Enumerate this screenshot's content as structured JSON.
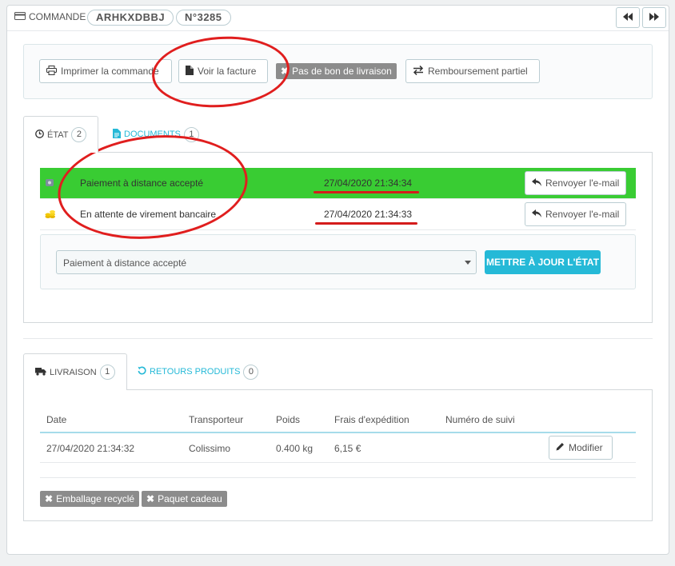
{
  "header": {
    "title": "COMMANDE",
    "reference": "ARHKXDBBJ",
    "order_number": "N°3285"
  },
  "actions": {
    "print": "Imprimer la commande",
    "invoice": "Voir la facture",
    "no_delivery_slip": "Pas de bon de livraison",
    "partial_refund": "Remboursement partiel"
  },
  "status_tabs": {
    "state_label": "ÉTAT",
    "state_count": "2",
    "documents_label": "DOCUMENTS",
    "documents_count": "1"
  },
  "history": [
    {
      "label": "Paiement à distance accepté",
      "date": "27/04/2020 21:34:34",
      "action": "Renvoyer l'e-mail",
      "color": "#39cc33"
    },
    {
      "label": "En attente de virement bancaire",
      "date": "27/04/2020 21:34:33",
      "action": "Renvoyer l'e-mail",
      "color": "#ffffff"
    }
  ],
  "state_select": {
    "value": "Paiement à distance accepté"
  },
  "update_state_button": "METTRE À JOUR L'ÉTAT",
  "shipping_tabs": {
    "delivery_label": "LIVRAISON",
    "delivery_count": "1",
    "returns_label": "RETOURS PRODUITS",
    "returns_count": "0"
  },
  "shipping_table": {
    "headers": [
      "Date",
      "Transporteur",
      "Poids",
      "Frais d'expédition",
      "Numéro de suivi"
    ],
    "rows": [
      {
        "date": "27/04/2020 21:34:32",
        "carrier": "Colissimo",
        "weight": "0.400 kg",
        "cost": "6,15 €",
        "tracking": "",
        "action": "Modifier"
      }
    ]
  },
  "tags": {
    "recycled": "Emballage recyclé",
    "gift": "Paquet cadeau"
  },
  "colors": {
    "accent": "#25b9d7",
    "status_green": "#39cc33",
    "annotation_red": "#e01e1e"
  }
}
